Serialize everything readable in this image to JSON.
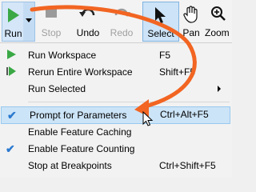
{
  "toolbar": {
    "run_label": "Run",
    "stop_label": "Stop",
    "undo_label": "Undo",
    "redo_label": "Redo",
    "select_label": "Select",
    "pan_label": "Pan",
    "zoom_label": "Zoom"
  },
  "menu": {
    "items": [
      {
        "label": "Run Workspace",
        "shortcut": "F5",
        "icon": "play-icon"
      },
      {
        "label": "Rerun Entire Workspace",
        "shortcut": "Shift+F5",
        "icon": "rerun-icon"
      },
      {
        "label": "Run Selected",
        "shortcut": "",
        "icon": "",
        "has_submenu": true
      },
      {
        "label": "Prompt for Parameters",
        "shortcut": "Ctrl+Alt+F5",
        "checked": true,
        "highlighted": true
      },
      {
        "label": "Enable Feature Caching",
        "shortcut": ""
      },
      {
        "label": "Enable Feature Counting",
        "shortcut": "",
        "checked": true
      },
      {
        "label": "Stop at Breakpoints",
        "shortcut": "Ctrl+Shift+F5"
      }
    ]
  },
  "colors": {
    "accent": "#2b79d0",
    "run_green": "#3aa845",
    "annotation_arrow": "#f26522",
    "highlight": "#cce4f7"
  }
}
